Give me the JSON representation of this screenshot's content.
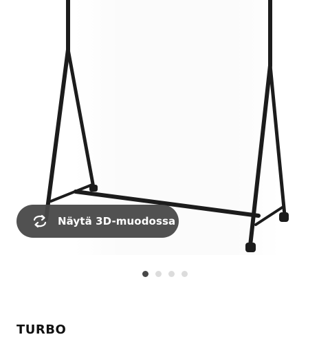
{
  "product_image": {
    "alt": "clothes rack",
    "icon": "clothes-rack-image"
  },
  "view_3d": {
    "label": "Näytä 3D-muodossa",
    "icon": "rotate-3d-icon"
  },
  "carousel": {
    "total": 4,
    "active_index": 0
  },
  "product": {
    "name": "TURBO"
  },
  "colors": {
    "button_bg": "#484848",
    "dot_active": "#484848",
    "dot_inactive": "#dcdcdc"
  }
}
